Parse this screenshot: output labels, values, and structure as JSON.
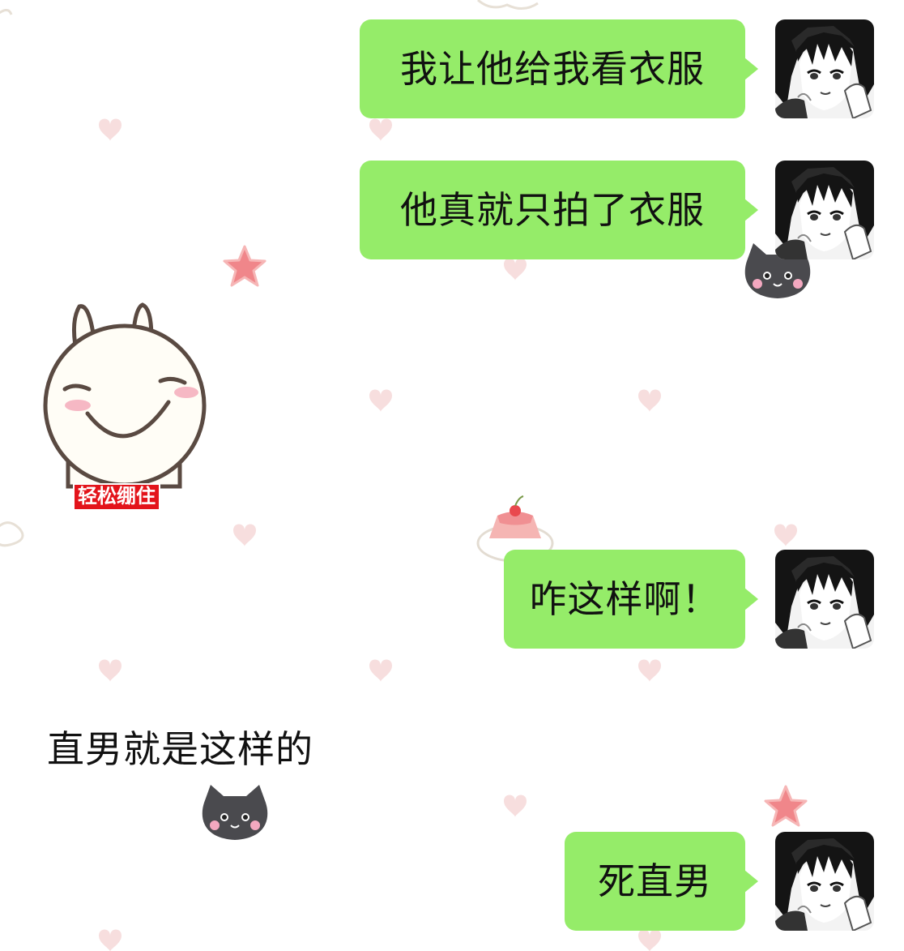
{
  "messages": [
    {
      "side": "right",
      "text": "我让他给我看衣服"
    },
    {
      "side": "right",
      "text": "他真就只拍了衣服"
    },
    {
      "side": "left",
      "type": "sticker",
      "caption": "轻松绷住"
    },
    {
      "side": "right",
      "text": "咋这样啊！"
    },
    {
      "side": "left",
      "text": "直男就是这样的"
    },
    {
      "side": "right",
      "text": "死直男"
    }
  ],
  "colors": {
    "bubble_self": "#95ec69",
    "background": "#ffffff",
    "sticker_caption_bg": "#e3141b"
  },
  "icons": {
    "avatar": "manga-girl-avatar",
    "sticker": "smiling-bunny-sticker",
    "decorations": [
      "heart-icon",
      "star-icon",
      "cat-icon",
      "pudding-icon",
      "cloud-icon"
    ]
  }
}
